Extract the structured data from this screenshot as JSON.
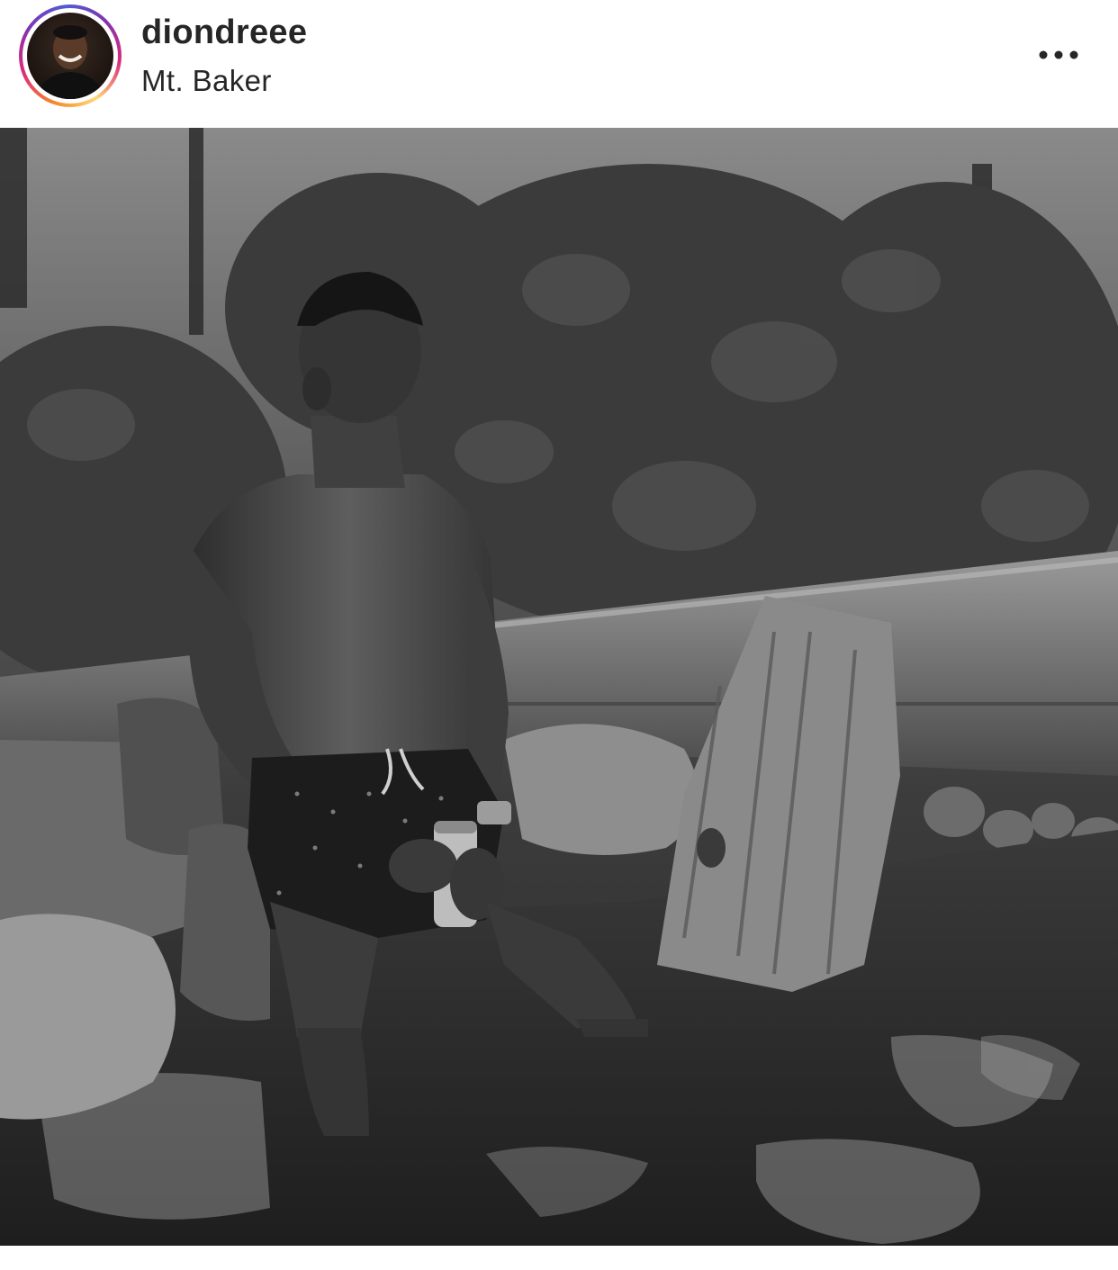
{
  "post": {
    "username": "diondreee",
    "location": "Mt. Baker"
  },
  "icons": {
    "more": "more-options-icon",
    "avatar": "profile-avatar"
  },
  "colors": {
    "text": "#262626",
    "ring_start": "#f58529",
    "ring_end": "#8134af"
  }
}
